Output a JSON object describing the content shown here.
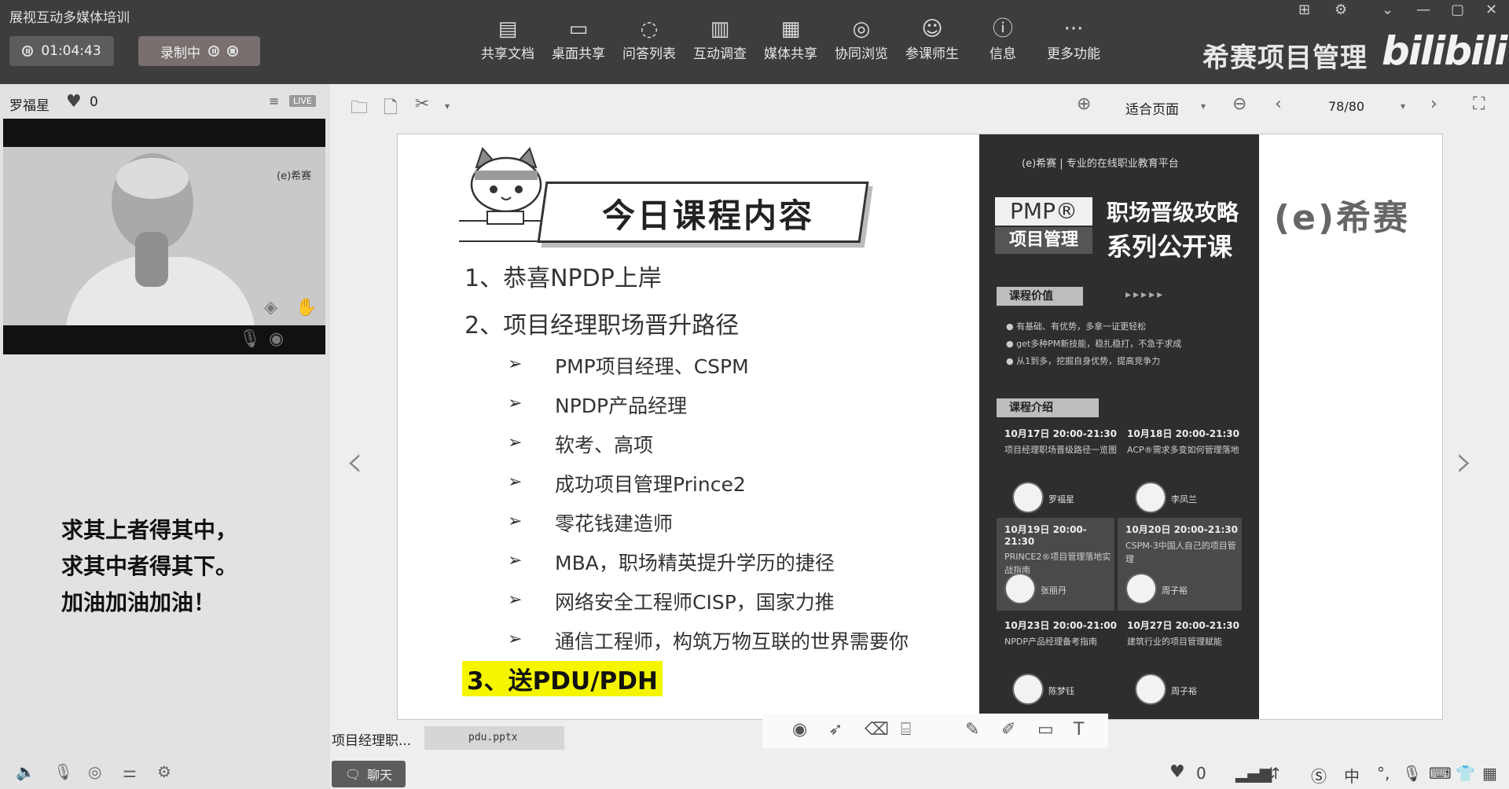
{
  "app": {
    "title": "展视互动多媒体培训",
    "timer": "01:04:43",
    "recording_label": "录制中"
  },
  "toolbar": {
    "items": [
      {
        "label": "共享文档",
        "icon": "document-share-icon"
      },
      {
        "label": "桌面共享",
        "icon": "desktop-share-icon"
      },
      {
        "label": "问答列表",
        "icon": "qa-list-icon"
      },
      {
        "label": "互动调查",
        "icon": "survey-chart-icon"
      },
      {
        "label": "媒体共享",
        "icon": "media-share-icon"
      },
      {
        "label": "协同浏览",
        "icon": "co-browse-icon"
      },
      {
        "label": "参课师生",
        "icon": "participants-icon"
      },
      {
        "label": "信息",
        "icon": "info-icon"
      },
      {
        "label": "更多功能",
        "icon": "more-icon"
      }
    ],
    "brand_name": "希赛项目管理",
    "brand_logo": "bilibili"
  },
  "left": {
    "presenter": "罗福星",
    "likes": "0",
    "live_badge": "LIVE",
    "video_watermark": "(e)希赛",
    "motto": [
      "求其上者得其中，",
      "求其中者得其下。",
      "加油加油加油！"
    ]
  },
  "doc_toolbar": {
    "fit_mode": "适合页面",
    "page": "78/80"
  },
  "slide": {
    "title": "今日课程内容",
    "item1": "1、恭喜NPDP上岸",
    "item2": "2、项目经理职场晋升路径",
    "subitems": [
      "PMP项目经理、CSPM",
      "NPDP产品经理",
      "软考、高项",
      "成功项目管理Prince2",
      "零花钱建造师",
      "MBA，职场精英提升学历的捷径",
      "网络安全工程师CISP，国家力推",
      "通信工程师，构筑万物互联的世界需要你"
    ],
    "item3": "3、送PDU/PDH",
    "right_logo": "(e)希赛"
  },
  "poster": {
    "header": "(e)希赛 | 专业的在线职业教育平台",
    "pmp": "PMP®",
    "pm": "项目管理",
    "title1": "职场晋级攻略",
    "title2": "系列公开课",
    "value_label": "课程价值",
    "arrows": "▸▸▸▸▸",
    "values": [
      "● 有基础、有优势，多拿一证更轻松",
      "● get多种PM新技能，稳扎稳打，不急于求成",
      "● 从1到多，挖掘自身优势，提高竞争力"
    ],
    "intro_label": "课程介绍",
    "cards": [
      {
        "date": "10月17日  20:00-21:30",
        "desc": "项目经理职场晋级路径一览图",
        "teacher": "罗福星"
      },
      {
        "date": "10月18日  20:00-21:30",
        "desc": "ACP®需求多变如何管理落地",
        "teacher": "李凤兰"
      },
      {
        "date": "10月19日  20:00-21:30",
        "desc": "PRINCE2®项目管理落地实战指南",
        "teacher": "张丽丹"
      },
      {
        "date": "10月20日  20:00-21:30",
        "desc": "CSPM-3中国人自己的项目管理",
        "teacher": "周子裕"
      },
      {
        "date": "10月23日  20:00-21:00",
        "desc": "NPDP产品经理备考指南",
        "teacher": "陈梦钰"
      },
      {
        "date": "10月27日  20:00-21:30",
        "desc": "建筑行业的项目管理赋能",
        "teacher": "周子裕"
      }
    ]
  },
  "bottom": {
    "file_label": "项目经理职...",
    "file_tab": "pdu.pptx",
    "chat_label": "聊天",
    "likes": "0",
    "ime": "中"
  }
}
